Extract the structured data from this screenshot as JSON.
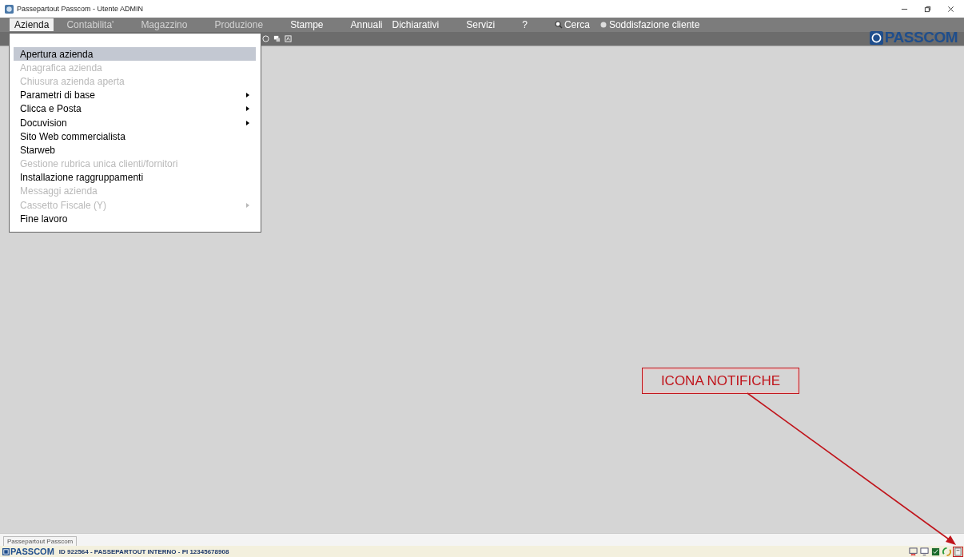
{
  "window": {
    "title": "Passepartout Passcom - Utente ADMIN"
  },
  "menu_bar": [
    {
      "label": "Azienda",
      "selected": true,
      "disabled": false
    },
    {
      "label": "Contabilita'",
      "selected": false,
      "disabled": true
    },
    {
      "label": "Magazzino",
      "selected": false,
      "disabled": true
    },
    {
      "label": "Produzione",
      "selected": false,
      "disabled": true
    },
    {
      "label": "Stampe",
      "selected": false,
      "disabled": false
    },
    {
      "label": "Annuali",
      "selected": false,
      "disabled": false
    },
    {
      "label": "Dichiarativi",
      "selected": false,
      "disabled": false
    },
    {
      "label": "Servizi",
      "selected": false,
      "disabled": false
    },
    {
      "label": "?",
      "selected": false,
      "disabled": false
    },
    {
      "label": "Cerca",
      "selected": false,
      "disabled": false,
      "kind": "search"
    },
    {
      "label": "Soddisfazione cliente",
      "selected": false,
      "disabled": false,
      "kind": "feedback"
    }
  ],
  "logo": "PASSCOM",
  "dropdown": [
    {
      "label": "Apertura azienda",
      "selected": true,
      "disabled": false,
      "submenu": false
    },
    {
      "label": "Anagrafica azienda",
      "selected": false,
      "disabled": true,
      "submenu": false
    },
    {
      "label": "Chiusura azienda aperta",
      "selected": false,
      "disabled": true,
      "submenu": false
    },
    {
      "label": "Parametri di base",
      "selected": false,
      "disabled": false,
      "submenu": true
    },
    {
      "label": "Clicca e Posta",
      "selected": false,
      "disabled": false,
      "submenu": true
    },
    {
      "label": "Docuvision",
      "selected": false,
      "disabled": false,
      "submenu": true
    },
    {
      "label": "Sito Web commercialista",
      "selected": false,
      "disabled": false,
      "submenu": false
    },
    {
      "label": "Starweb",
      "selected": false,
      "disabled": false,
      "submenu": false
    },
    {
      "label": "Gestione rubrica unica clienti/fornitori",
      "selected": false,
      "disabled": true,
      "submenu": false
    },
    {
      "label": "Installazione raggruppamenti",
      "selected": false,
      "disabled": false,
      "submenu": false
    },
    {
      "label": "Messaggi azienda",
      "selected": false,
      "disabled": true,
      "submenu": false
    },
    {
      "label": "Cassetto Fiscale (Y)",
      "selected": false,
      "disabled": true,
      "submenu": true
    },
    {
      "label": "Fine lavoro",
      "selected": false,
      "disabled": false,
      "submenu": false
    }
  ],
  "annotation": "ICONA NOTIFICHE",
  "tabs": [
    {
      "label": "Passepartout Passcom",
      "selected": true
    }
  ],
  "status_bar": {
    "logo": "PASSCOM",
    "text": "ID 922564 - PASSEPARTOUT INTERNO - PI 12345678908"
  }
}
